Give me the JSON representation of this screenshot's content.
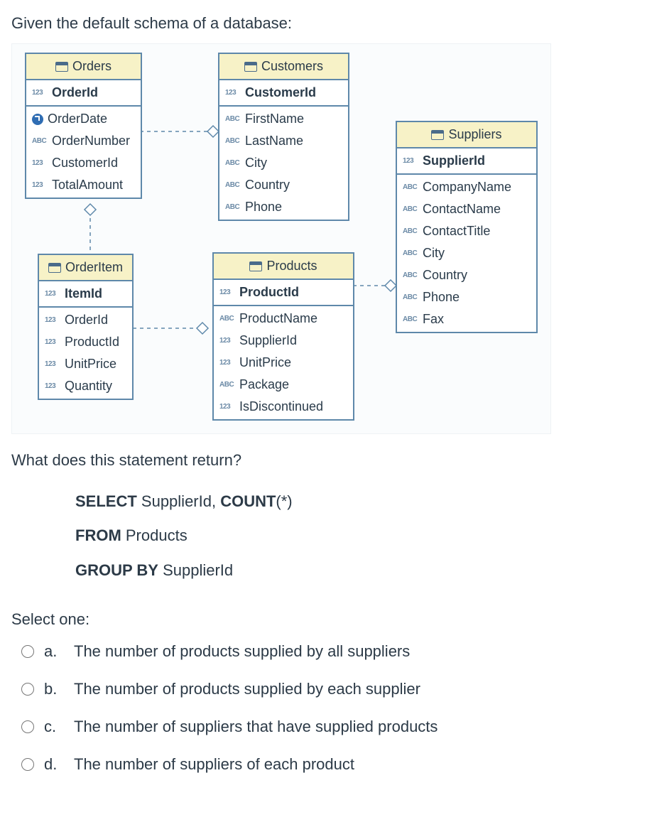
{
  "intro": "Given the default schema of a database:",
  "tables": {
    "orders": {
      "title": "Orders",
      "pk": "OrderId",
      "cols": [
        {
          "type": "clock",
          "name": "OrderDate"
        },
        {
          "type": "abc",
          "name": "OrderNumber"
        },
        {
          "type": "num",
          "name": "CustomerId"
        },
        {
          "type": "num",
          "name": "TotalAmount"
        }
      ]
    },
    "customers": {
      "title": "Customers",
      "pk": "CustomerId",
      "cols": [
        {
          "type": "abc",
          "name": "FirstName"
        },
        {
          "type": "abc",
          "name": "LastName"
        },
        {
          "type": "abc",
          "name": "City"
        },
        {
          "type": "abc",
          "name": "Country"
        },
        {
          "type": "abc",
          "name": "Phone"
        }
      ]
    },
    "suppliers": {
      "title": "Suppliers",
      "pk": "SupplierId",
      "cols": [
        {
          "type": "abc",
          "name": "CompanyName"
        },
        {
          "type": "abc",
          "name": "ContactName"
        },
        {
          "type": "abc",
          "name": "ContactTitle"
        },
        {
          "type": "abc",
          "name": "City"
        },
        {
          "type": "abc",
          "name": "Country"
        },
        {
          "type": "abc",
          "name": "Phone"
        },
        {
          "type": "abc",
          "name": "Fax"
        }
      ]
    },
    "orderitem": {
      "title": "OrderItem",
      "pk": "ItemId",
      "cols": [
        {
          "type": "num",
          "name": "OrderId"
        },
        {
          "type": "num",
          "name": "ProductId"
        },
        {
          "type": "num",
          "name": "UnitPrice"
        },
        {
          "type": "num",
          "name": "Quantity"
        }
      ]
    },
    "products": {
      "title": "Products",
      "pk": "ProductId",
      "cols": [
        {
          "type": "abc",
          "name": "ProductName"
        },
        {
          "type": "num",
          "name": "SupplierId"
        },
        {
          "type": "num",
          "name": "UnitPrice"
        },
        {
          "type": "abc",
          "name": "Package"
        },
        {
          "type": "num",
          "name": "IsDiscontinued"
        }
      ]
    }
  },
  "q2": "What does this statement return?",
  "sql": {
    "line1_kw1": "SELECT",
    "line1_rest": " SupplierId, ",
    "line1_kw2": "COUNT",
    "line1_tail": "(*)",
    "line2_kw": "FROM",
    "line2_rest": " Products",
    "line3_kw": "GROUP BY",
    "line3_rest": " SupplierId"
  },
  "selectone": "Select one:",
  "options": [
    {
      "letter": "a.",
      "text": "The number of products supplied by all suppliers"
    },
    {
      "letter": "b.",
      "text": "The number of products supplied by each supplier"
    },
    {
      "letter": "c.",
      "text": "The number of suppliers that have supplied products"
    },
    {
      "letter": "d.",
      "text": "The number of suppliers of each product"
    }
  ]
}
